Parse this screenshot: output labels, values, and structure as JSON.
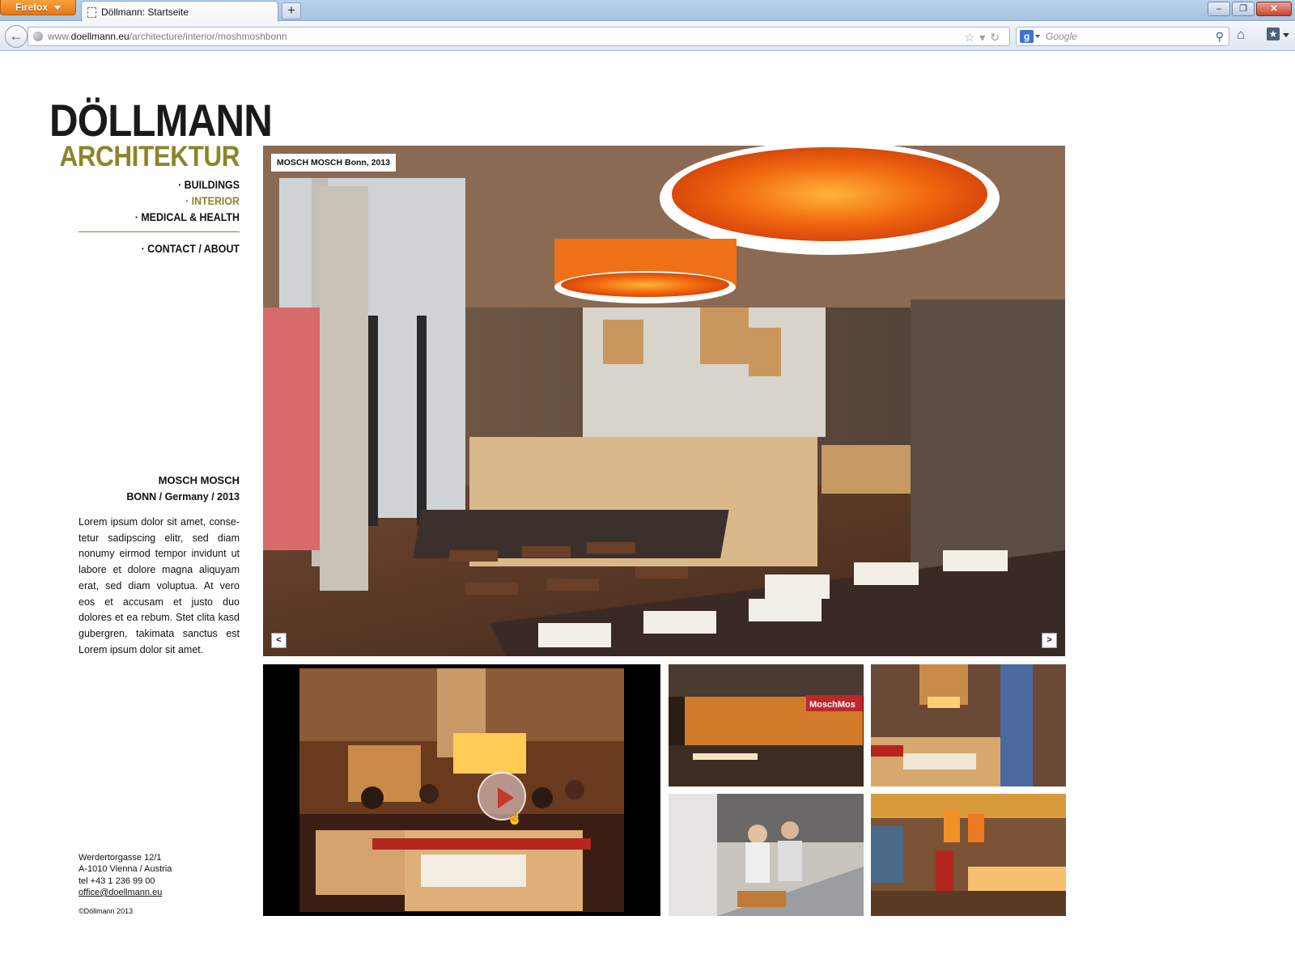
{
  "browser": {
    "app_button": "Firefox",
    "tab_title": "Döllmann: Startseite",
    "new_tab": "+",
    "url_prefix": "www.",
    "url_domain": "doellmann.eu",
    "url_path": "/architecture/interior/moshmoshbonn",
    "search_placeholder": "Google",
    "search_engine_icon": "google-icon",
    "window_buttons": [
      "minimize",
      "restore",
      "close"
    ]
  },
  "logo": {
    "line1": "DÖLLMANN",
    "line2": "ARCHITEKTUR",
    "accent_color": "#8d842b"
  },
  "nav": {
    "items": [
      {
        "label": "· BUILDINGS",
        "active": false
      },
      {
        "label": "· INTERIOR",
        "active": true
      },
      {
        "label": "· MEDICAL & HEALTH",
        "active": false
      }
    ],
    "contact": "· CONTACT / ABOUT"
  },
  "project": {
    "title": "MOSCH MOSCH",
    "subtitle": "BONN / Germany / 2013",
    "description": "Lorem ipsum dolor sit amet, conse-tetur sadipscing elitr, sed diam nonumy eirmod tempor invidunt ut labore et dolore magna aliquyam erat, sed diam voluptua. At vero eos et accusam et justo duo dolores et ea rebum. Stet clita kasd gubergren, takimata sanctus est Lorem ipsum dolor sit amet."
  },
  "gallery": {
    "caption": "MOSCH MOSCH Bonn, 2013",
    "prev": "<",
    "next": ">",
    "sign_text": "MoschMos"
  },
  "footer": {
    "street": "Werdertorgasse 12/1",
    "city": "A-1010 Vienna / Austria",
    "tel": "tel +43 1 236 99 00",
    "email": "office@doellmann.eu",
    "copyright": "©Döllmann 2013"
  }
}
